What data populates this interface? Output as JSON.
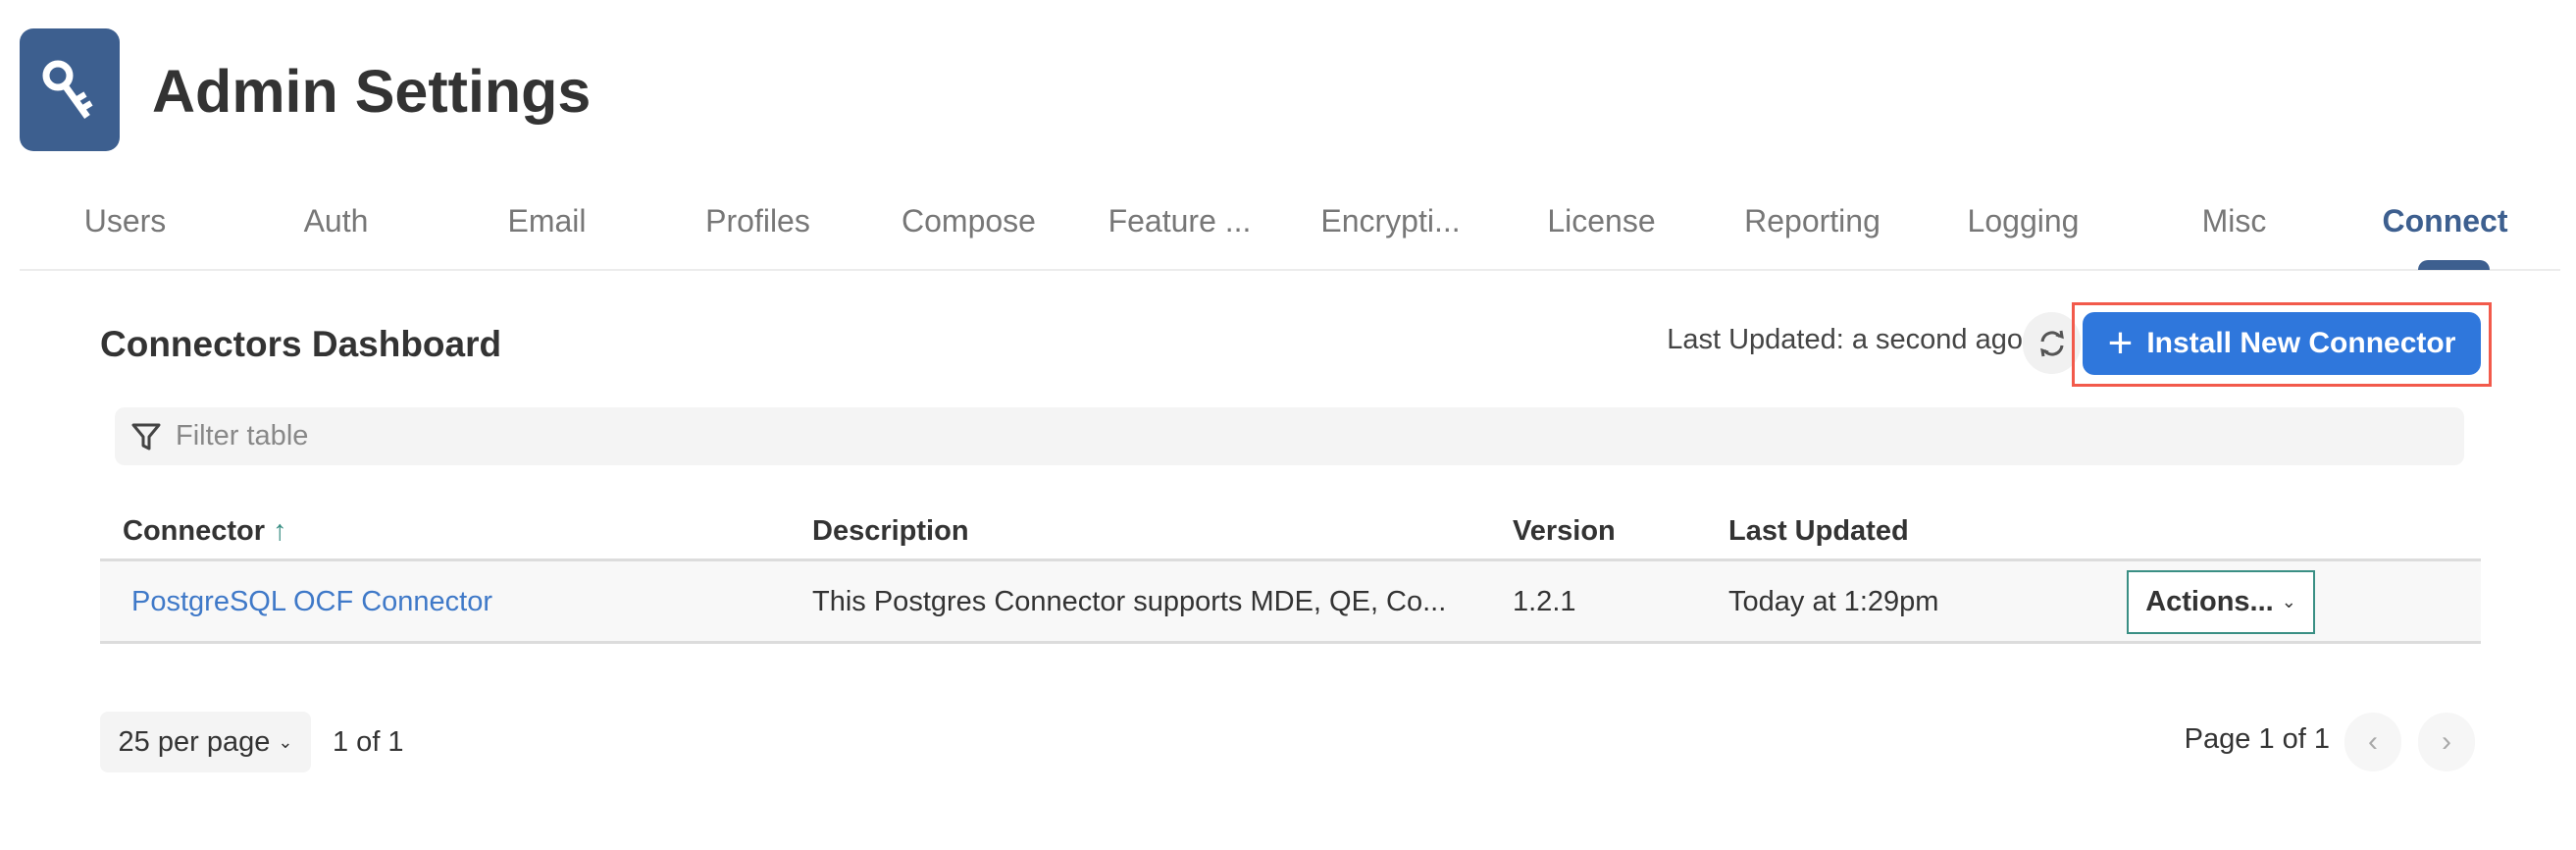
{
  "header": {
    "title": "Admin Settings",
    "logo_icon": "key-icon",
    "logo_color": "#3d5f8f"
  },
  "tabs": [
    {
      "label": "Users"
    },
    {
      "label": "Auth"
    },
    {
      "label": "Email"
    },
    {
      "label": "Profiles"
    },
    {
      "label": "Compose"
    },
    {
      "label": "Feature ..."
    },
    {
      "label": "Encrypti..."
    },
    {
      "label": "License"
    },
    {
      "label": "Reporting"
    },
    {
      "label": "Logging"
    },
    {
      "label": "Misc"
    },
    {
      "label": "Connect",
      "active": true
    }
  ],
  "dashboard": {
    "title": "Connectors Dashboard",
    "last_updated": "Last Updated: a second ago",
    "install_button": "Install New Connector",
    "accent": "#2f77dc",
    "filter_placeholder": "Filter table",
    "filter_value": ""
  },
  "table": {
    "columns": [
      "Connector",
      "Description",
      "Version",
      "Last Updated"
    ],
    "sort": {
      "column": "Connector",
      "direction": "ascending"
    },
    "rows": [
      {
        "connector": "PostgreSQL OCF Connector",
        "description": "This Postgres Connector supports MDE, QE, Co...",
        "version": "1.2.1",
        "last_updated": "Today at 1:29pm",
        "actions": "Actions..."
      }
    ]
  },
  "pagination": {
    "per_page": "25 per page",
    "count": "1 of 1",
    "page_label": "Page 1 of 1"
  }
}
